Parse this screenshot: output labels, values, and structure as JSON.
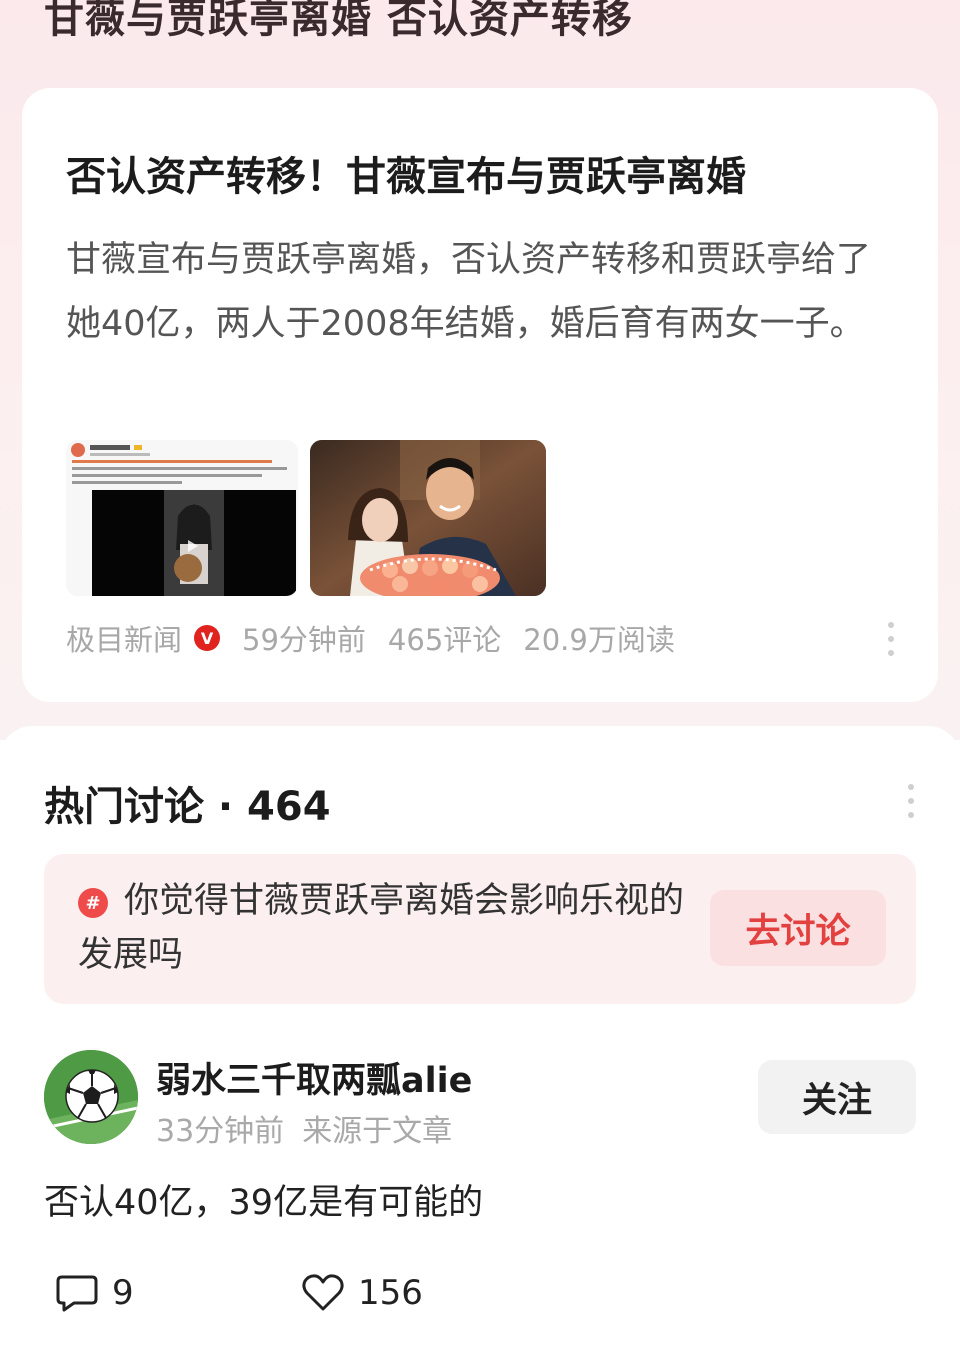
{
  "header": {
    "title": "甘薇与贾跃亭离婚 否认资产转移"
  },
  "article": {
    "title": "否认资产转移！甘薇宣布与贾跃亭离婚",
    "summary": "甘薇宣布与贾跃亭离婚，否认资产转移和贾跃亭给了她40亿，两人于2008年结婚，婚后育有两女一子。",
    "source": "极目新闻",
    "verified_badge": "V",
    "time": "59分钟前",
    "comments": "465评论",
    "reads": "20.9万阅读",
    "thumbnails": [
      "weibo-post-screenshot",
      "couple-photo-with-flowers"
    ]
  },
  "hot_discussion": {
    "title": "热门讨论",
    "count_sep": " · ",
    "count": "464",
    "topic": {
      "icon": "#",
      "text": "你觉得甘薇贾跃亭离婚会影响乐视的发展吗",
      "button": "去讨论"
    }
  },
  "comment": {
    "username": "弱水三千取两瓢alie",
    "time": "33分钟前",
    "source": "来源于文章",
    "follow": "关注",
    "text": "否认40亿，39亿是有可能的",
    "reply_count": "9",
    "like_count": "156",
    "avatar_icon": "soccer-ball"
  },
  "colors": {
    "accent": "#e2413f",
    "topic_bg": "#fbeff0",
    "verified": "#e0231f",
    "meta_gray": "#a8a8a8"
  }
}
